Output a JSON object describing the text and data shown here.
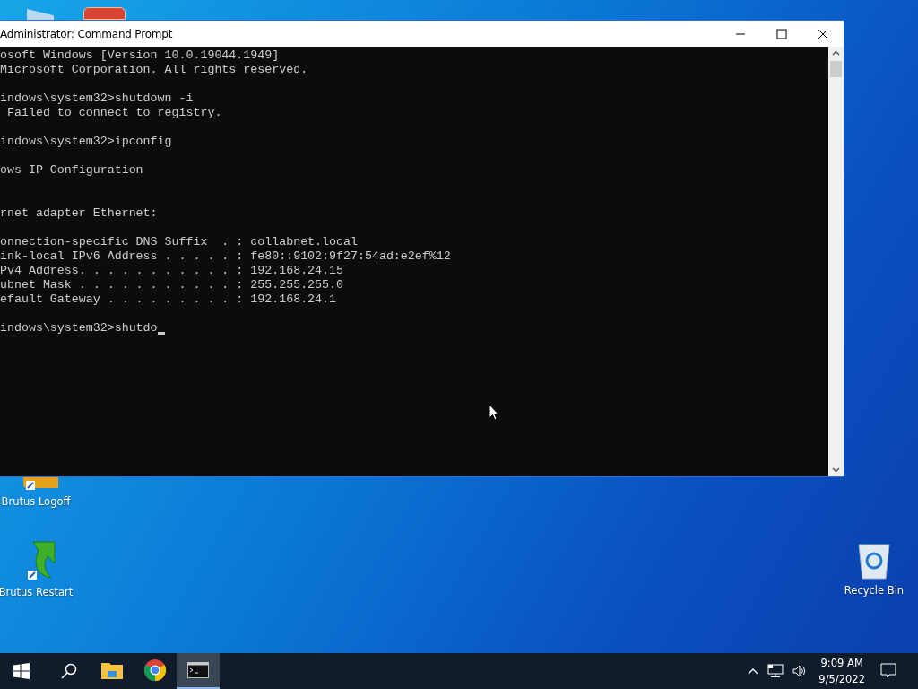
{
  "desktop_icons": [
    {
      "label": "Brutus Logoff",
      "kind": "logoff"
    },
    {
      "label": "Brutus Restart",
      "kind": "restart"
    },
    {
      "label": "Recycle Bin",
      "kind": "bin"
    }
  ],
  "window": {
    "title": "Administrator: Command Prompt",
    "console": {
      "blocks": [
        {
          "kind": "first",
          "lines": [
            "osoft Windows [Version 10.0.19044.1949]",
            "Microsoft Corporation. All rights reserved."
          ]
        },
        {
          "kind": "normal",
          "lines": [
            "indows\\system32>shutdown -i",
            " Failed to connect to registry."
          ]
        },
        {
          "kind": "normal",
          "lines": [
            "indows\\system32>ipconfig"
          ]
        },
        {
          "kind": "normal",
          "lines": [
            "ows IP Configuration"
          ]
        },
        {
          "kind": "wide",
          "lines": [
            "rnet adapter Ethernet:"
          ]
        },
        {
          "kind": "normal",
          "lines": [
            "onnection-specific DNS Suffix  . : collabnet.local",
            "ink-local IPv6 Address . . . . . : fe80::9102:9f27:54ad:e2ef%12",
            "Pv4 Address. . . . . . . . . . . : 192.168.24.15",
            "ubnet Mask . . . . . . . . . . . : 255.255.255.0",
            "efault Gateway . . . . . . . . . : 192.168.24.1"
          ]
        }
      ],
      "current_line": "indows\\system32>shutdo"
    }
  },
  "taskbar": {
    "apps": [
      {
        "kind": "explorer",
        "selected": false
      },
      {
        "kind": "chrome",
        "selected": false
      },
      {
        "kind": "cmd",
        "selected": true
      }
    ],
    "clock": {
      "time": "9:09 AM",
      "date": "9/5/2022"
    }
  }
}
